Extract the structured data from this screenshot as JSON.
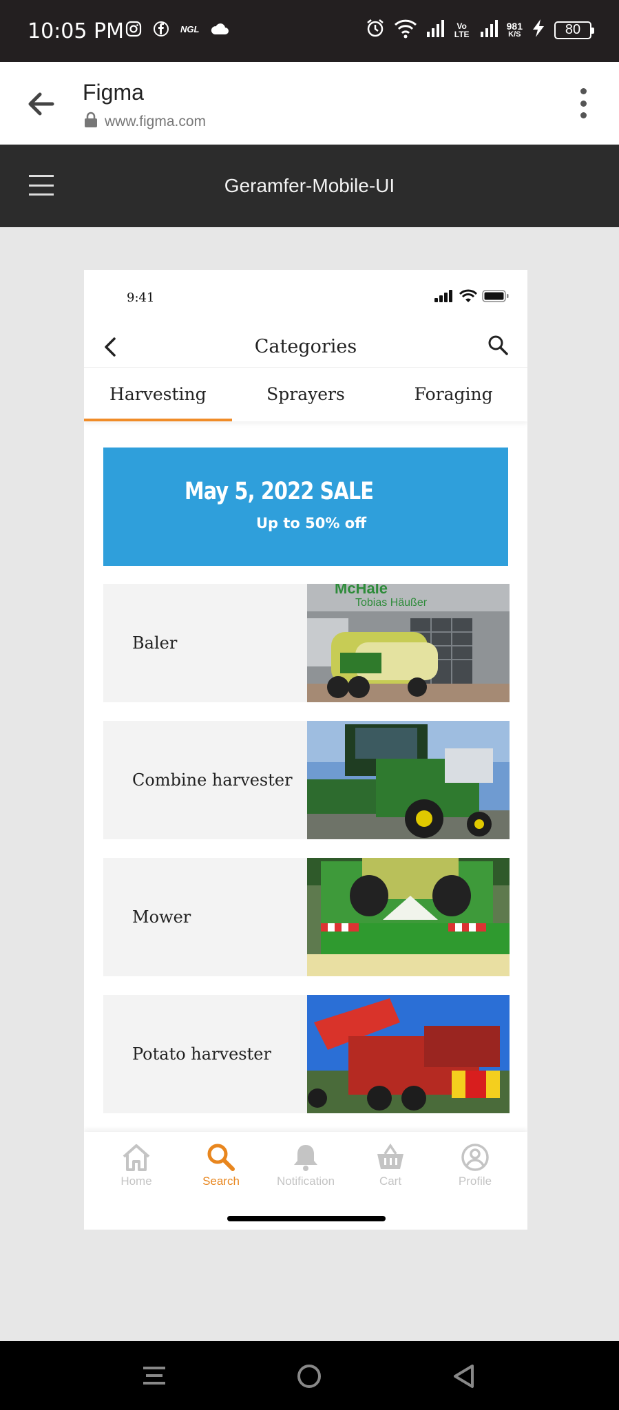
{
  "status_bar": {
    "time": "10:05 PM",
    "app_icons": [
      "instagram-icon",
      "facebook-icon",
      "ngl-icon",
      "cloud-icon"
    ],
    "ngl_label": "NGL",
    "volte": "Vo LTE",
    "speed_value": "981",
    "speed_unit": "K/S",
    "battery": "80"
  },
  "browser": {
    "title": "Figma",
    "url": "www.figma.com"
  },
  "figma_toolbar": {
    "title": "Geramfer-Mobile-UI"
  },
  "phone": {
    "status_time": "9:41",
    "header_title": "Categories",
    "tabs": [
      {
        "label": "Harvesting",
        "active": true
      },
      {
        "label": "Sprayers",
        "active": false
      },
      {
        "label": "Foraging",
        "active": false
      }
    ],
    "banner": {
      "title": "May 5, 2022 SALE",
      "subtitle": "Up to 50% off",
      "color": "#2f9fdb"
    },
    "categories": [
      {
        "label": "Baler",
        "image_text": "McHale",
        "image_text2": "Tobias Häußer"
      },
      {
        "label": "Combine harvester"
      },
      {
        "label": "Mower"
      },
      {
        "label": "Potato harvester"
      }
    ],
    "bottom_nav": [
      {
        "label": "Home",
        "icon": "home-icon",
        "active": false
      },
      {
        "label": "Search",
        "icon": "search-icon",
        "active": true
      },
      {
        "label": "Notification",
        "icon": "bell-icon",
        "active": false
      },
      {
        "label": "Cart",
        "icon": "basket-icon",
        "active": false
      },
      {
        "label": "Profile",
        "icon": "profile-icon",
        "active": false
      }
    ],
    "accent_color": "#f08c28"
  }
}
